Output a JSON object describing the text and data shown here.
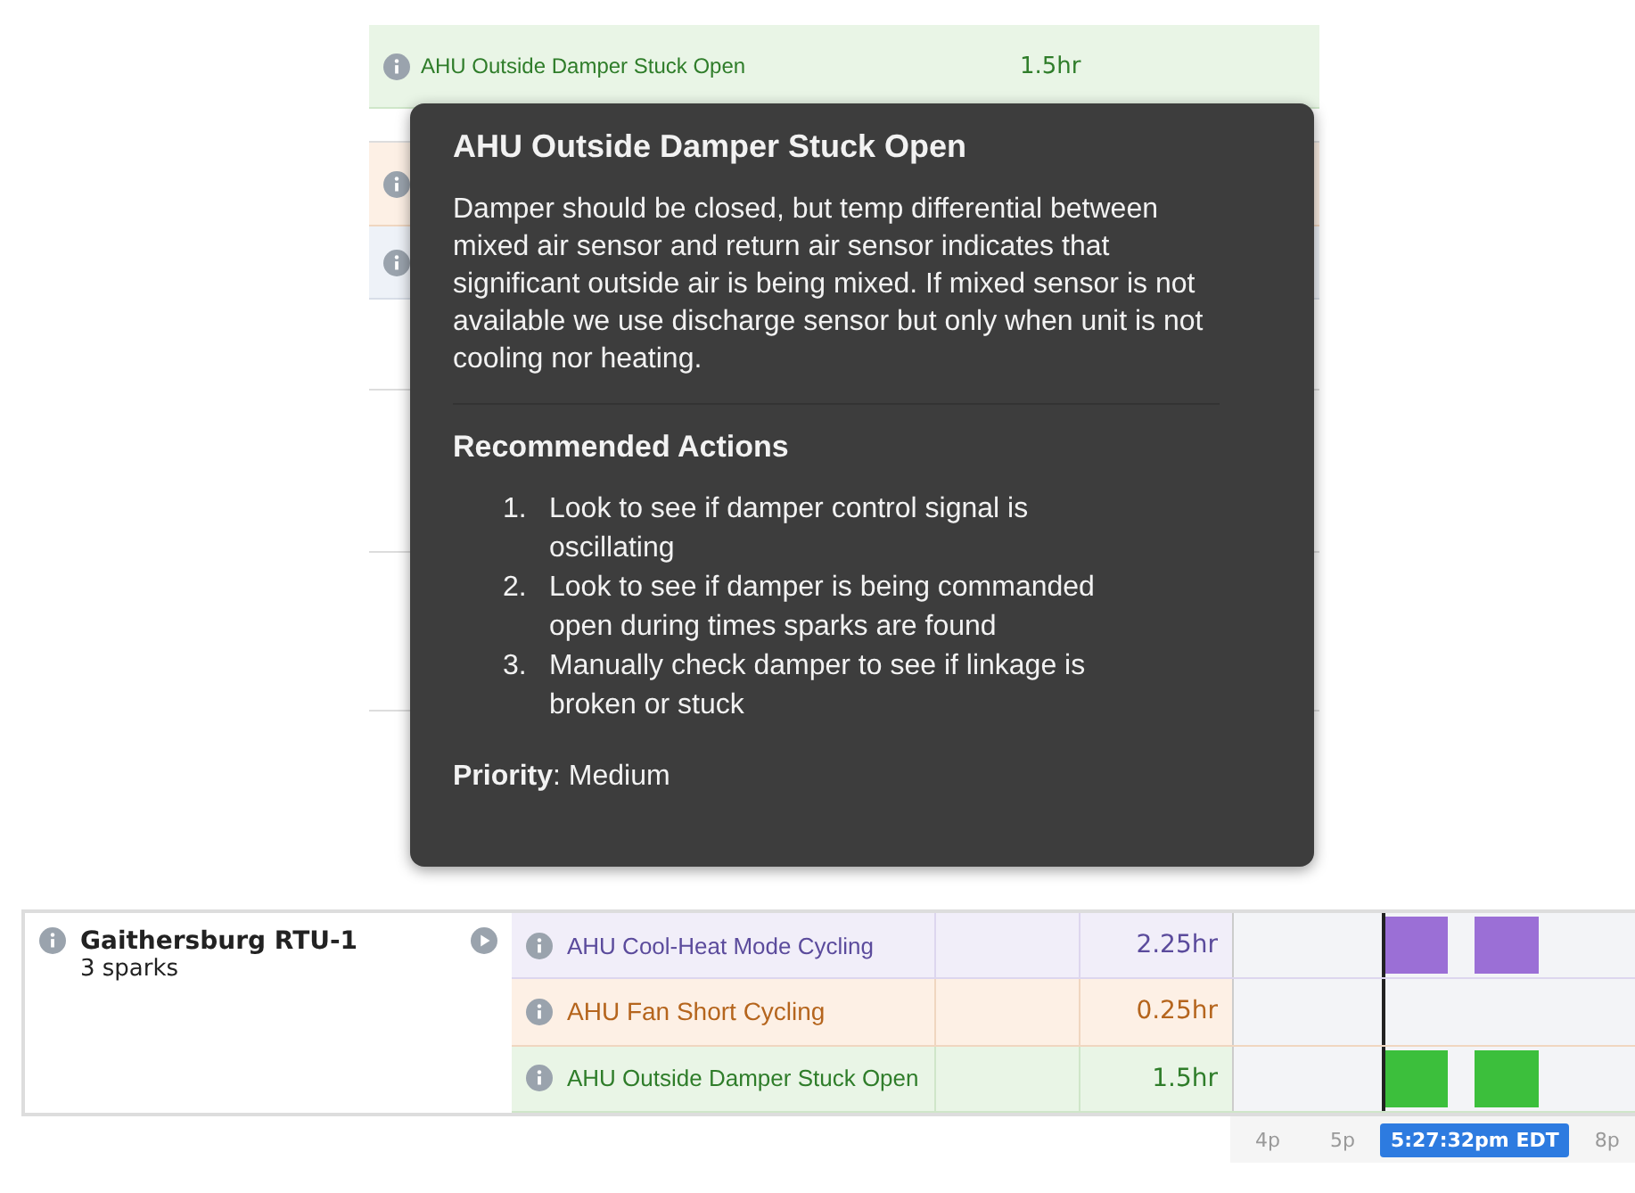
{
  "background_rows": [
    {
      "kind": "green",
      "label": "AHU Outside Damper Stuck Open",
      "duration": "1.5hr"
    },
    {
      "kind": "blank"
    },
    {
      "kind": "orange"
    },
    {
      "kind": "blue"
    },
    {
      "kind": "blank"
    },
    {
      "kind": "blank"
    },
    {
      "kind": "blank"
    }
  ],
  "tooltip": {
    "title": "AHU Outside Damper Stuck Open",
    "description": "Damper should be closed, but temp differential between mixed air sensor and return air sensor indicates that significant outside air is being mixed. If mixed sensor is not available we use discharge sensor but only when unit is not cooling nor heating.",
    "actions_heading": "Recommended Actions",
    "actions": [
      {
        "number": "1.",
        "text": "Look to see if damper control signal is oscillating"
      },
      {
        "number": "2.",
        "text": "Look to see if damper is being commanded open during times sparks are found"
      },
      {
        "number": "3.",
        "text": "Manually check damper to see if linkage is broken or stuck"
      }
    ],
    "priority": "**Priority**: Medium"
  },
  "unit": {
    "name": "Gaithersburg RTU-1",
    "sparks_count": "3 sparks"
  },
  "sparks": [
    {
      "kind": "purple",
      "label": "AHU Cool-Heat Mode Cycling",
      "duration": "2.25hr"
    },
    {
      "kind": "orange",
      "label": "AHU Fan Short Cycling",
      "duration": "0.25hr"
    },
    {
      "kind": "green",
      "label": "AHU Outside Damper Stuck Open",
      "duration": "1.5hr"
    }
  ],
  "axis": [
    {
      "kind": "tick",
      "label": "4p"
    },
    {
      "kind": "tick",
      "label": "5p"
    },
    {
      "kind": "current",
      "label": "5:27:32pm EDT"
    },
    {
      "kind": "tick",
      "label": "8p"
    }
  ]
}
